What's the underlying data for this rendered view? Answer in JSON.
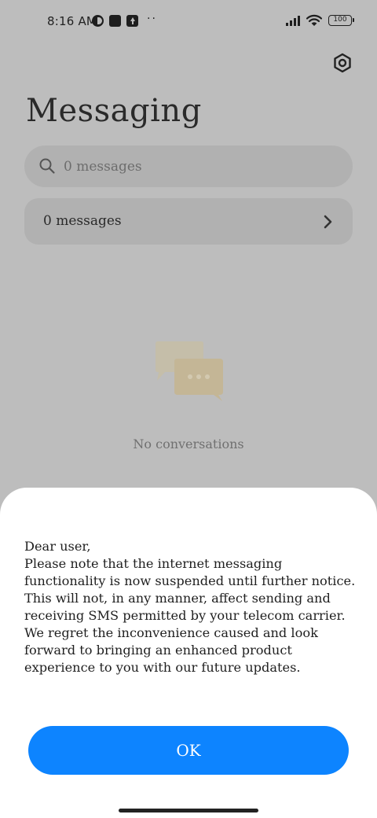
{
  "status_bar": {
    "time": "8:16 AM",
    "dots": "··",
    "battery": "100"
  },
  "header": {
    "title": "Messaging"
  },
  "search": {
    "placeholder": "0 messages"
  },
  "messages_row": {
    "label": "0 messages"
  },
  "empty_state": {
    "text": "No conversations"
  },
  "dialog": {
    "body": "Dear user,\nPlease note that the internet messaging functionality is now suspended until further notice. This will not, in any manner, affect sending and receiving SMS permitted by your telecom carrier. We regret the inconvenience caused and look forward to bringing an enhanced product experience to you with our future updates.",
    "ok_label": "OK"
  },
  "colors": {
    "accent": "#0d84ff",
    "scrim_background": "#bdbdbd",
    "sheet": "#ffffff"
  },
  "icons": [
    "settings-icon",
    "search-icon",
    "chevron-right-icon",
    "chat-bubbles-icon",
    "signal-icon",
    "wifi-icon",
    "battery-icon"
  ]
}
